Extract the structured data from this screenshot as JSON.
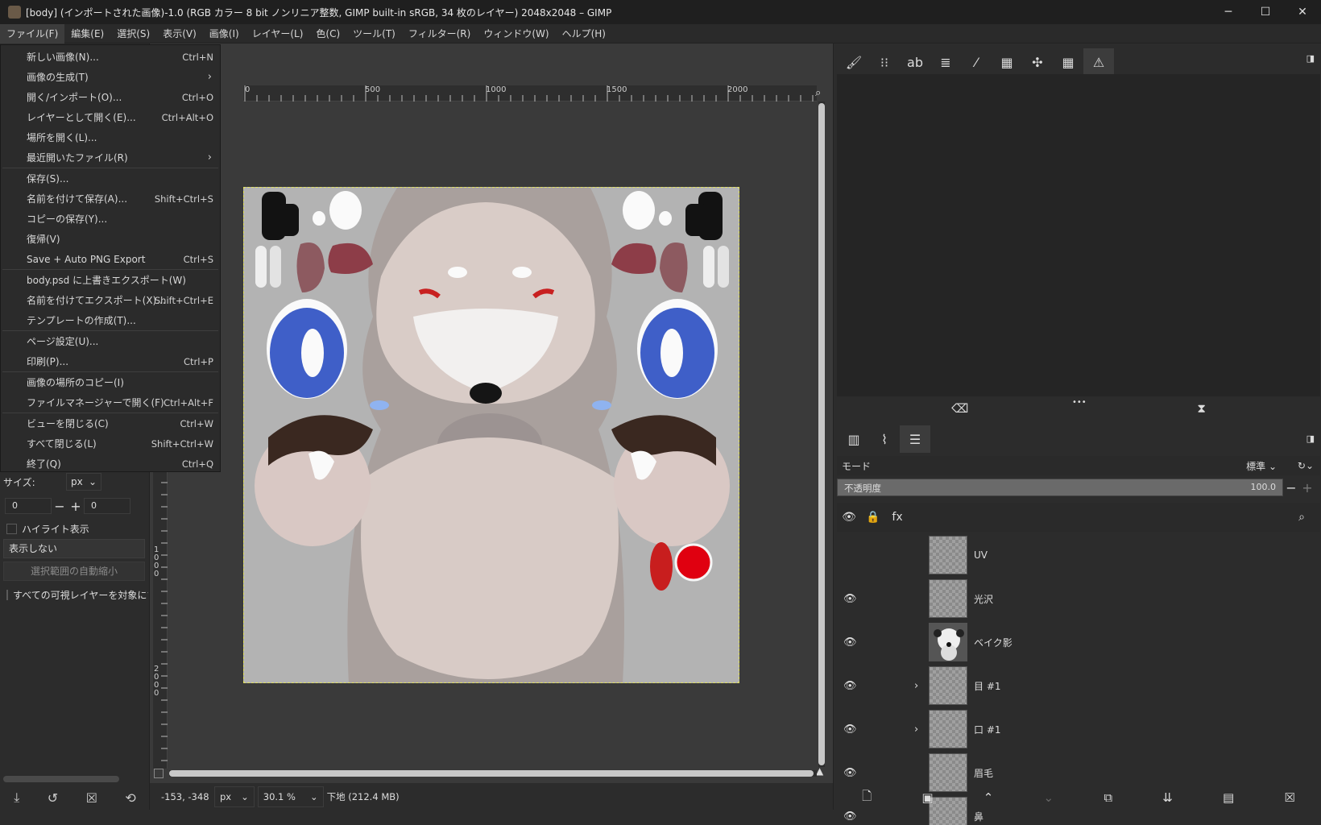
{
  "window": {
    "title": "[body] (インポートされた画像)-1.0 (RGB カラー 8 bit ノンリニア整数, GIMP built-in sRGB, 34 枚のレイヤー) 2048x2048 – GIMP",
    "min": "─",
    "max": "☐",
    "close": "✕"
  },
  "menubar": [
    "ファイル(F)",
    "編集(E)",
    "選択(S)",
    "表示(V)",
    "画像(I)",
    "レイヤー(L)",
    "色(C)",
    "ツール(T)",
    "フィルター(R)",
    "ウィンドウ(W)",
    "ヘルプ(H)"
  ],
  "file_menu": [
    {
      "label": "新しい画像(N)...",
      "shortcut": "Ctrl+N"
    },
    {
      "label": "画像の生成(T)",
      "submenu": true
    },
    {
      "label": "開く/インポート(O)...",
      "shortcut": "Ctrl+O"
    },
    {
      "label": "レイヤーとして開く(E)...",
      "shortcut": "Ctrl+Alt+O"
    },
    {
      "label": "場所を開く(L)...",
      "shortcut": ""
    },
    {
      "label": "最近開いたファイル(R)",
      "submenu": true,
      "sep_after": true
    },
    {
      "label": "保存(S)...",
      "shortcut": ""
    },
    {
      "label": "名前を付けて保存(A)...",
      "shortcut": "Shift+Ctrl+S"
    },
    {
      "label": "コピーの保存(Y)...",
      "shortcut": ""
    },
    {
      "label": "復帰(V)",
      "shortcut": ""
    },
    {
      "label": "Save + Auto PNG Export",
      "shortcut": "Ctrl+S",
      "sep_after": true
    },
    {
      "label": "body.psd に上書きエクスポート(W)",
      "shortcut": ""
    },
    {
      "label": "名前を付けてエクスポート(X)...",
      "shortcut": "Shift+Ctrl+E"
    },
    {
      "label": "テンプレートの作成(T)...",
      "shortcut": "",
      "sep_after": true
    },
    {
      "label": "ページ設定(U)...",
      "shortcut": ""
    },
    {
      "label": "印刷(P)...",
      "shortcut": "Ctrl+P",
      "sep_after": true
    },
    {
      "label": "画像の場所のコピー(I)",
      "shortcut": ""
    },
    {
      "label": "ファイルマネージャーで開く(F)",
      "shortcut": "Ctrl+Alt+F",
      "sep_after": true
    },
    {
      "label": "ビューを閉じる(C)",
      "shortcut": "Ctrl+W"
    },
    {
      "label": "すべて閉じる(L)",
      "shortcut": "Shift+Ctrl+W"
    },
    {
      "label": "終了(Q)",
      "shortcut": "Ctrl+Q"
    }
  ],
  "tool_options": {
    "pos_x": "0",
    "pos_y": "0",
    "size_label": "サイズ:",
    "size_unit": "px",
    "size_w": "0",
    "size_h": "0",
    "highlight_label": "ハイライト表示",
    "guides_value": "表示しない",
    "auto_shrink_label": "選択範囲の自動縮小",
    "all_visible_label": "すべての可視レイヤーを対象にする"
  },
  "rulers": {
    "h_labels": [
      "0",
      "500",
      "1000",
      "1500",
      "2000"
    ],
    "v_labels": [
      "1000",
      "2000"
    ]
  },
  "status": {
    "coords": "-153, -348",
    "unit": "px",
    "zoom": "30.1 %",
    "message": "下地 (212.4 MB)"
  },
  "layers_panel": {
    "mode_label": "モード",
    "mode_value": "標準",
    "opacity_label": "不透明度",
    "opacity_value": "100.0",
    "opacity_fraction": 1.0,
    "layers": [
      {
        "name": "UV",
        "visible": false,
        "expandable": false
      },
      {
        "name": "光沢",
        "visible": true,
        "expandable": false
      },
      {
        "name": "ベイク影",
        "visible": true,
        "expandable": false,
        "thumb": "face"
      },
      {
        "name": "目 #1",
        "visible": true,
        "expandable": true
      },
      {
        "name": "口 #1",
        "visible": true,
        "expandable": true
      },
      {
        "name": "眉毛",
        "visible": true,
        "expandable": false
      },
      {
        "name": "鼻",
        "visible": true,
        "expandable": false
      }
    ]
  },
  "colors": {
    "canvas_bg": "#b3b3b3",
    "skin": "#d9ccc7",
    "dark_skin": "#a79d9a",
    "eye_blue": "#3f5fc8",
    "mouth_red": "#c81e1e",
    "hair_dark": "#3a2820"
  }
}
